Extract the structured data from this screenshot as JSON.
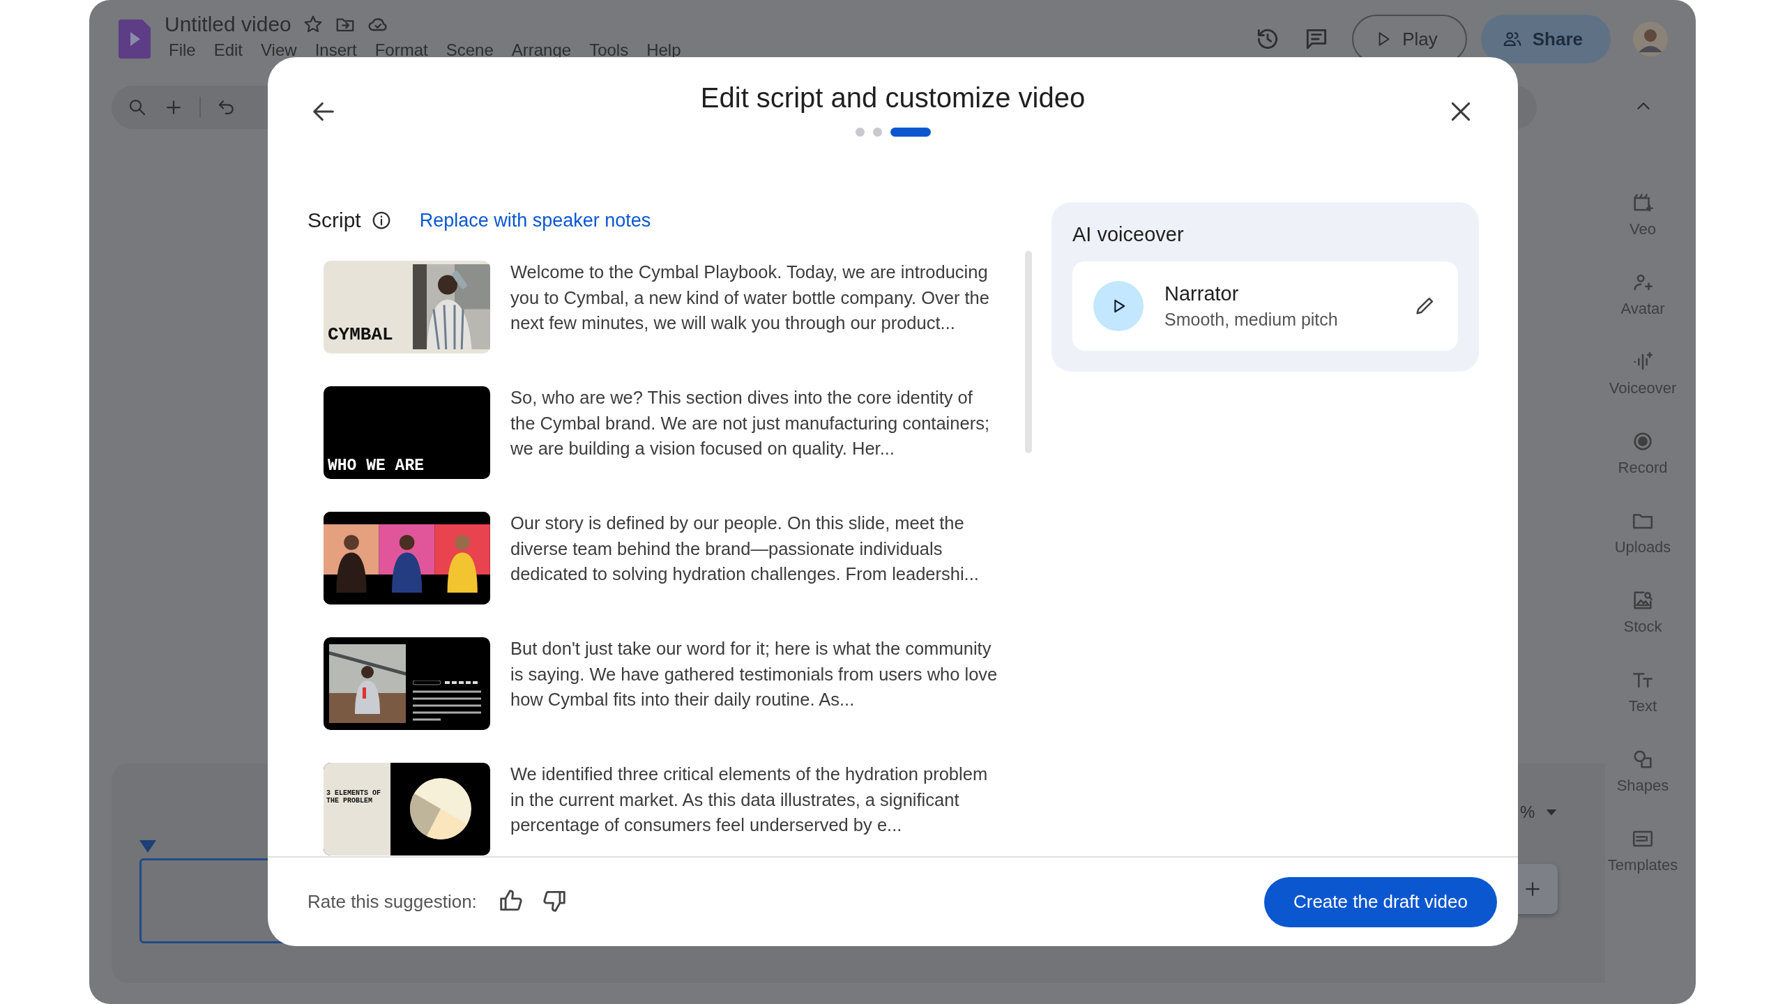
{
  "app": {
    "title": "Untitled video",
    "menu": [
      "File",
      "Edit",
      "View",
      "Insert",
      "Format",
      "Scene",
      "Arrange",
      "Tools",
      "Help"
    ],
    "play_button": "Play",
    "share_button": "Share",
    "side_panel": [
      {
        "label": "Veo"
      },
      {
        "label": "Avatar"
      },
      {
        "label": "Voiceover"
      },
      {
        "label": "Record"
      },
      {
        "label": "Uploads"
      },
      {
        "label": "Stock"
      },
      {
        "label": "Text"
      },
      {
        "label": "Shapes"
      },
      {
        "label": "Templates"
      }
    ],
    "timeline": {
      "zoom": "%"
    }
  },
  "dialog": {
    "title": "Edit script and customize video",
    "steps": [
      {
        "selected": false
      },
      {
        "selected": false
      },
      {
        "selected": true
      }
    ],
    "script_label": "Script",
    "replace_link": "Replace with speaker notes",
    "scenes": [
      {
        "kind": "cover",
        "slide_title": "CYMBAL",
        "text": "Welcome to the Cymbal Playbook. Today, we are introducing you to Cymbal, a new kind of water bottle company. Over the next few minutes, we will walk you through our product..."
      },
      {
        "kind": "title",
        "slide_title": "WHO WE ARE",
        "text": "So, who are we? This section dives into the core identity of the Cymbal brand. We are not just manufacturing containers; we are building a vision focused on quality. Her..."
      },
      {
        "kind": "team",
        "text": "Our story is defined by our people. On this slide, meet the diverse team behind the brand—passionate individuals dedicated to solving hydration challenges. From leadershi..."
      },
      {
        "kind": "testimonial",
        "text": "But don't just take our word for it; here is what the community is saying. We have gathered testimonials from users who love how Cymbal fits into their daily routine. As..."
      },
      {
        "kind": "chart",
        "slide_title": "3 ELEMENTS OF THE PROBLEM",
        "text": "We identified three critical elements of the hydration problem in the current market. As this data illustrates, a significant percentage of consumers feel underserved by e..."
      }
    ],
    "voiceover": {
      "title": "AI voiceover",
      "voice": "Narrator",
      "description": "Smooth, medium pitch"
    },
    "rate_label": "Rate this suggestion:",
    "create_button": "Create the draft video"
  }
}
